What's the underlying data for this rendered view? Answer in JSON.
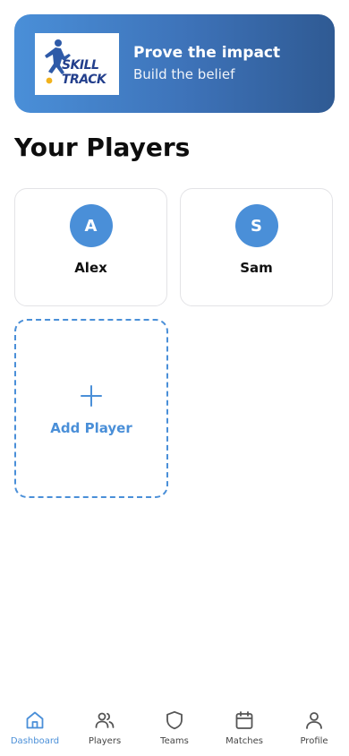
{
  "hero": {
    "logo_line1": "SKILL",
    "logo_line2": "TRACK",
    "title": "Prove the impact",
    "subtitle": "Build the belief"
  },
  "section": {
    "title": "Your Players"
  },
  "players": [
    {
      "initial": "A",
      "name": "Alex"
    },
    {
      "initial": "S",
      "name": "Sam"
    }
  ],
  "add_player": {
    "label": "Add Player"
  },
  "nav": {
    "items": [
      {
        "label": "Dashboard",
        "icon": "home-icon",
        "active": true
      },
      {
        "label": "Players",
        "icon": "users-icon",
        "active": false
      },
      {
        "label": "Teams",
        "icon": "shield-icon",
        "active": false
      },
      {
        "label": "Matches",
        "icon": "calendar-icon",
        "active": false
      },
      {
        "label": "Profile",
        "icon": "user-icon",
        "active": false
      }
    ]
  },
  "colors": {
    "accent": "#4a8fd8",
    "banner_start": "#4a8fd8",
    "banner_end": "#2f5a93",
    "logo_navy": "#233f8c"
  }
}
